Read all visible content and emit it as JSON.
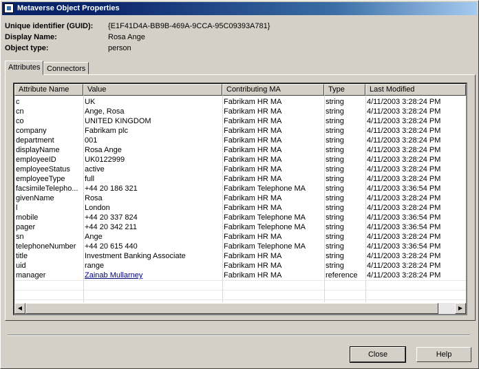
{
  "window": {
    "title": "Metaverse Object Properties"
  },
  "info": {
    "guid_label": "Unique identifier (GUID):",
    "guid_value": "{E1F41D4A-BB9B-469A-9CCA-95C09393A781}",
    "display_label": "Display Name:",
    "display_value": "Rosa Ange",
    "type_label": "Object type:",
    "type_value": "person"
  },
  "tabs": [
    {
      "label": "Attributes"
    },
    {
      "label": "Connectors"
    }
  ],
  "table": {
    "columns": [
      "Attribute Name",
      "Value",
      "Contributing MA",
      "Type",
      "Last Modified"
    ],
    "rows": [
      [
        "c",
        "UK",
        "Fabrikam HR MA",
        "string",
        "4/11/2003 3:28:24 PM"
      ],
      [
        "cn",
        "Ange, Rosa",
        "Fabrikam HR MA",
        "string",
        "4/11/2003 3:28:24 PM"
      ],
      [
        "co",
        "UNITED KINGDOM",
        "Fabrikam HR MA",
        "string",
        "4/11/2003 3:28:24 PM"
      ],
      [
        "company",
        "Fabrikam plc",
        "Fabrikam HR MA",
        "string",
        "4/11/2003 3:28:24 PM"
      ],
      [
        "department",
        "001",
        "Fabrikam HR MA",
        "string",
        "4/11/2003 3:28:24 PM"
      ],
      [
        "displayName",
        "Rosa Ange",
        "Fabrikam HR MA",
        "string",
        "4/11/2003 3:28:24 PM"
      ],
      [
        "employeeID",
        "UK0122999",
        "Fabrikam HR MA",
        "string",
        "4/11/2003 3:28:24 PM"
      ],
      [
        "employeeStatus",
        "active",
        "Fabrikam HR MA",
        "string",
        "4/11/2003 3:28:24 PM"
      ],
      [
        "employeeType",
        "full",
        "Fabrikam HR MA",
        "string",
        "4/11/2003 3:28:24 PM"
      ],
      [
        "facsimileTelepho...",
        "+44 20 186 321",
        "Fabrikam Telephone MA",
        "string",
        "4/11/2003 3:36:54 PM"
      ],
      [
        "givenName",
        "Rosa",
        "Fabrikam HR MA",
        "string",
        "4/11/2003 3:28:24 PM"
      ],
      [
        "l",
        "London",
        "Fabrikam HR MA",
        "string",
        "4/11/2003 3:28:24 PM"
      ],
      [
        "mobile",
        "+44 20 337 824",
        "Fabrikam Telephone MA",
        "string",
        "4/11/2003 3:36:54 PM"
      ],
      [
        "pager",
        "+44 20 342 211",
        "Fabrikam Telephone MA",
        "string",
        "4/11/2003 3:36:54 PM"
      ],
      [
        "sn",
        "Ange",
        "Fabrikam HR MA",
        "string",
        "4/11/2003 3:28:24 PM"
      ],
      [
        "telephoneNumber",
        "+44 20 615 440",
        "Fabrikam Telephone MA",
        "string",
        "4/11/2003 3:36:54 PM"
      ],
      [
        "title",
        "Investment Banking Associate",
        "Fabrikam HR MA",
        "string",
        "4/11/2003 3:28:24 PM"
      ],
      [
        "uid",
        "range",
        "Fabrikam HR MA",
        "string",
        "4/11/2003 3:28:24 PM"
      ],
      [
        "manager",
        "Zainab Mullarney",
        "Fabrikam HR MA",
        "reference",
        "4/11/2003 3:28:24 PM"
      ]
    ],
    "link_row": 18
  },
  "buttons": {
    "close": "Close",
    "help": "Help"
  },
  "colors": {
    "title_active": "#0a246a",
    "face": "#d4d0c8",
    "link": "#00007f"
  }
}
